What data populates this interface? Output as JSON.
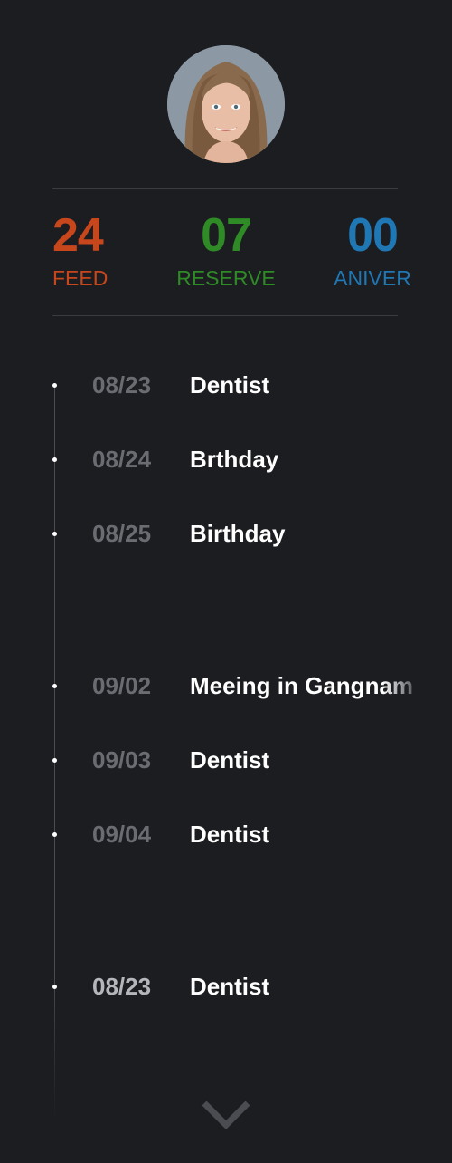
{
  "profile": {
    "avatar_alt": "profile-photo"
  },
  "stats": [
    {
      "value": "24",
      "label": "FEED",
      "color": "#c8461c"
    },
    {
      "value": "07",
      "label": "RESERVE",
      "color": "#2e8b25"
    },
    {
      "value": "00",
      "label": "ANIVER",
      "color": "#1f77b4"
    }
  ],
  "events": [
    {
      "date": "08/23",
      "title": "Dentist"
    },
    {
      "date": "08/24",
      "title": "Brthday"
    },
    {
      "date": "08/25",
      "title": "Birthday"
    },
    {
      "date": "09/02",
      "title": "Meeing in Gangnam"
    },
    {
      "date": "09/03",
      "title": "Dentist"
    },
    {
      "date": "09/04",
      "title": "Dentist"
    },
    {
      "date": "08/23",
      "title": "Dentist"
    }
  ],
  "icons": {
    "scroll_more": "chevron-down-icon"
  }
}
